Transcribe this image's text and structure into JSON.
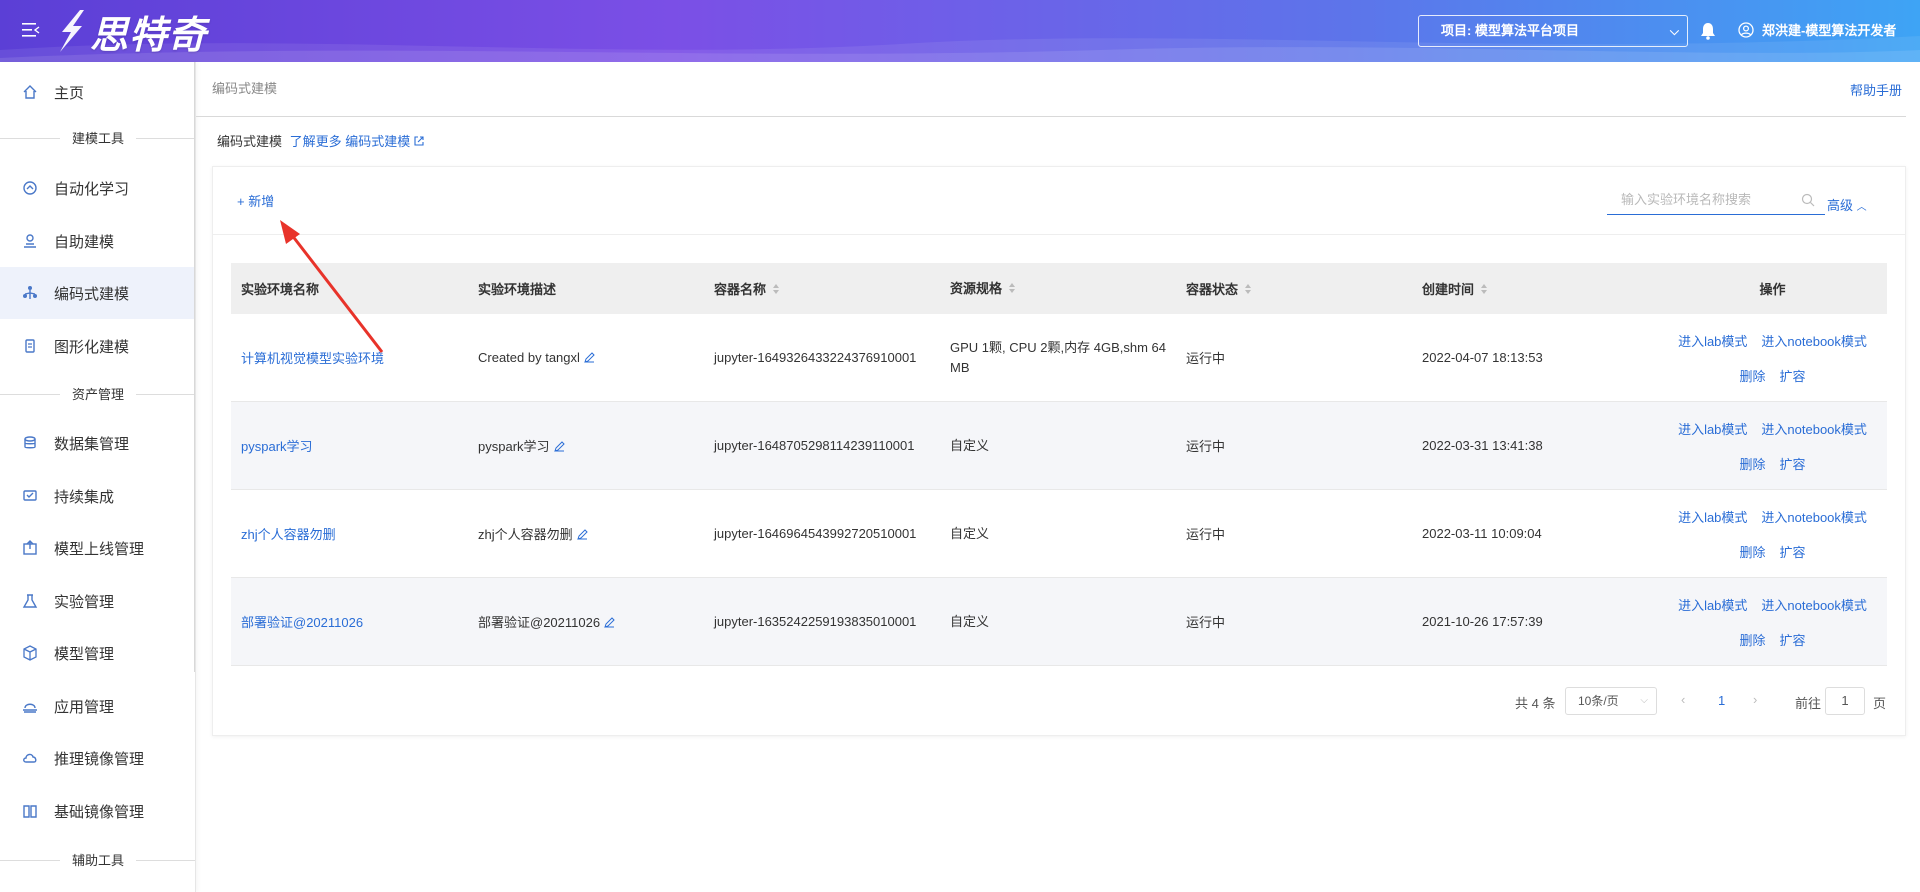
{
  "header": {
    "logo_text": "思特奇",
    "project_label": "项目: 模型算法平台项目",
    "user_label": "郑洪建-模型算法开发者"
  },
  "sidebar": {
    "items": [
      {
        "label": "主页",
        "icon": "home-icon"
      },
      {
        "section": "建模工具"
      },
      {
        "label": "自动化学习",
        "icon": "auto-learn-icon"
      },
      {
        "label": "自助建模",
        "icon": "self-model-icon"
      },
      {
        "label": "编码式建模",
        "icon": "code-model-icon",
        "active": true
      },
      {
        "label": "图形化建模",
        "icon": "graphic-model-icon"
      },
      {
        "section": "资产管理"
      },
      {
        "label": "数据集管理",
        "icon": "database-icon"
      },
      {
        "label": "持续集成",
        "icon": "integration-icon"
      },
      {
        "label": "模型上线管理",
        "icon": "deploy-icon"
      },
      {
        "label": "实验管理",
        "icon": "flask-icon"
      },
      {
        "label": "模型管理",
        "icon": "cube-icon"
      },
      {
        "label": "应用管理",
        "icon": "app-icon"
      },
      {
        "label": "推理镜像管理",
        "icon": "cloud-icon"
      },
      {
        "label": "基础镜像管理",
        "icon": "book-icon"
      },
      {
        "section": "辅助工具"
      }
    ]
  },
  "page": {
    "breadcrumb": "编码式建模",
    "help": "帮助手册",
    "intro_title": "编码式建模",
    "intro_link": "了解更多 编码式建模"
  },
  "toolbar": {
    "add_label": "+ 新增",
    "search_placeholder": "输入实验环境名称搜索",
    "advanced_label": "高级"
  },
  "table": {
    "headers": [
      "实验环境名称",
      "实验环境描述",
      "容器名称",
      "资源规格",
      "容器状态",
      "创建时间",
      "操作"
    ],
    "rows": [
      {
        "name": "计算机视觉模型实验环境",
        "desc": "Created by tangxl",
        "container": "jupyter-1649326433224376910001",
        "spec": "GPU 1颗, CPU 2颗,内存 4GB,shm 64 MB",
        "status": "运行中",
        "created": "2022-04-07 18:13:53"
      },
      {
        "name": "pyspark学习",
        "desc": "pyspark学习",
        "container": "jupyter-1648705298114239110001",
        "spec": "自定义",
        "status": "运行中",
        "created": "2022-03-31 13:41:38"
      },
      {
        "name": "zhj个人容器勿删",
        "desc": "zhj个人容器勿删",
        "container": "jupyter-1646964543992720510001",
        "spec": "自定义",
        "status": "运行中",
        "created": "2022-03-11 10:09:04"
      },
      {
        "name": "部署验证@20211026",
        "desc": "部署验证@20211026",
        "container": "jupyter-1635242259193835010001",
        "spec": "自定义",
        "status": "运行中",
        "created": "2021-10-26 17:57:39"
      }
    ],
    "ops": {
      "lab": "进入lab模式",
      "notebook": "进入notebook模式",
      "delete": "删除",
      "expand": "扩容"
    }
  },
  "pagination": {
    "total": "共 4 条",
    "page_size": "10条/页",
    "current": "1",
    "goto": "前往",
    "goto_value": "1",
    "page_unit": "页"
  },
  "colors": {
    "accent": "#2a6dd6",
    "header_start": "#5b3fd6",
    "header_end": "#3ea4f5",
    "annotation_arrow": "#e8332a"
  }
}
